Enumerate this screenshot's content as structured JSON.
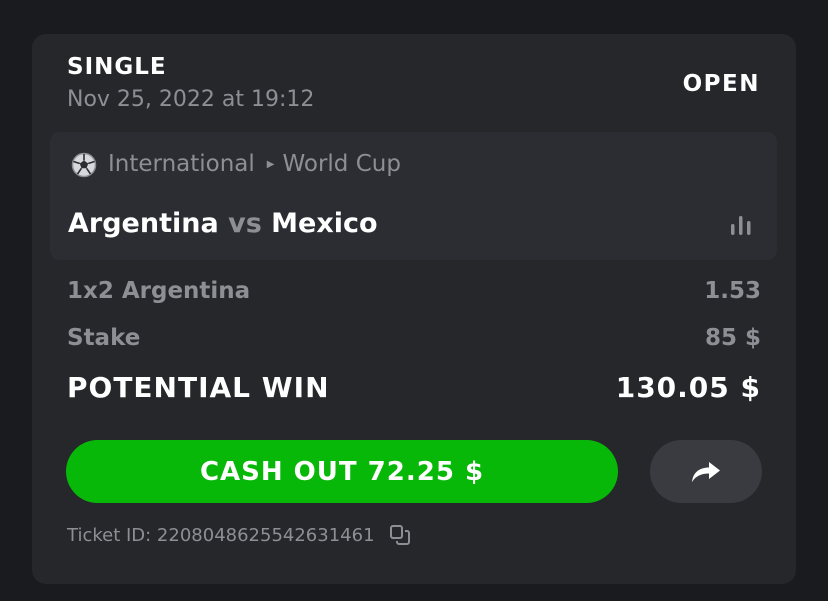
{
  "bet": {
    "type": "SINGLE",
    "date": "Nov 25, 2022 at 19:12",
    "status": "OPEN"
  },
  "event": {
    "category": "International",
    "league": "World Cup",
    "home": "Argentina",
    "vs": "vs",
    "away": "Mexico",
    "sport_icon": "soccer-ball-icon"
  },
  "selection": {
    "label": "1x2 Argentina",
    "odds": "1.53"
  },
  "stake": {
    "label": "Stake",
    "value": "85 $"
  },
  "potential_win": {
    "label": "POTENTIAL WIN",
    "value": "130.05 $"
  },
  "actions": {
    "cashout_label": "CASH OUT 72.25 $",
    "share_icon": "share-arrow-icon"
  },
  "ticket": {
    "id_text": "Ticket ID: 2208048625542631461",
    "copy_icon": "copy-icon"
  },
  "colors": {
    "background": "#1a1b1e",
    "card": "#26272b",
    "accent_green": "#08b808",
    "muted_text": "#8e8f94"
  }
}
